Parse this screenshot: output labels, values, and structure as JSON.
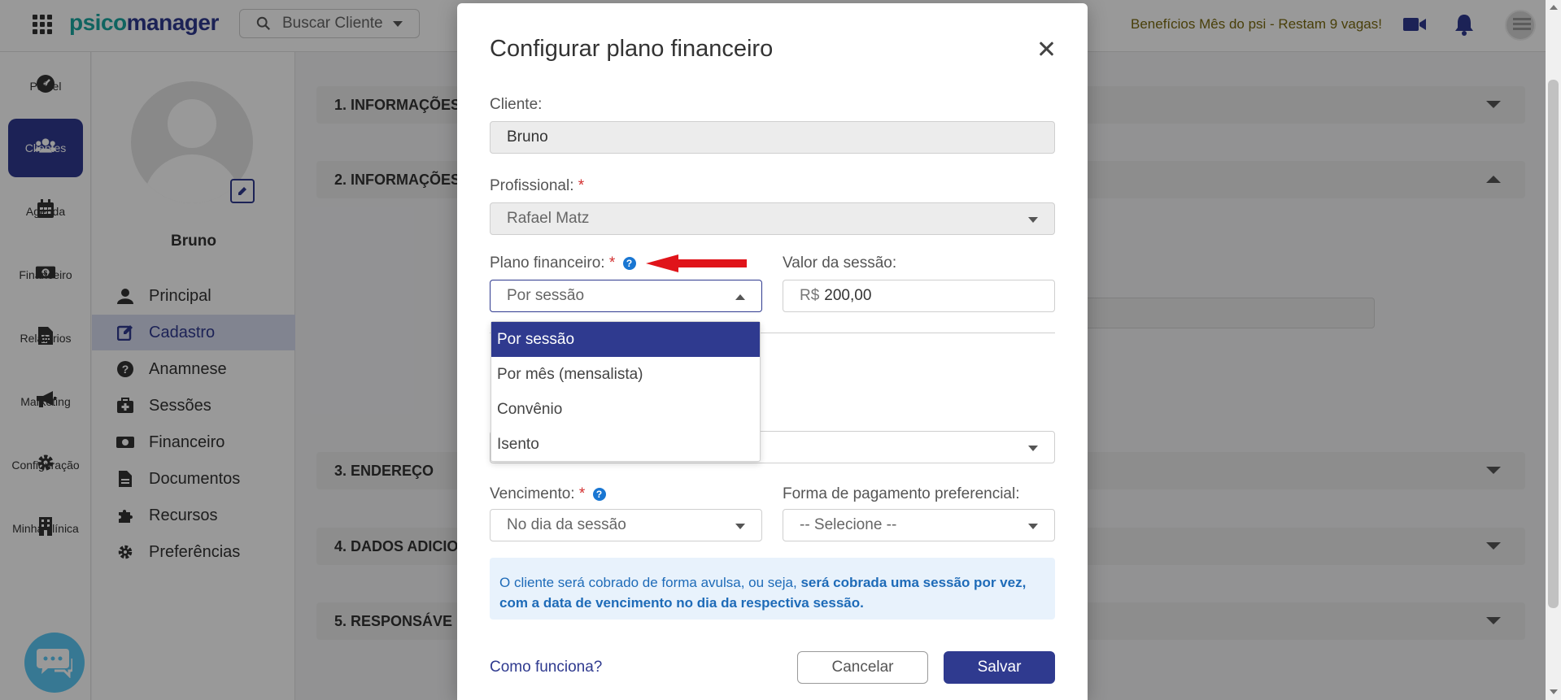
{
  "brand": {
    "logo_part1": "psico",
    "logo_part2": "manager"
  },
  "topbar": {
    "search_label": "Buscar Cliente",
    "promo": "Benefícios Mês do psi - Restam 9 vagas!"
  },
  "nav": {
    "items": [
      {
        "label": "Painel",
        "icon": "dashboard-icon"
      },
      {
        "label": "Clientes",
        "icon": "users-icon",
        "active": true
      },
      {
        "label": "Agenda",
        "icon": "calendar-icon"
      },
      {
        "label": "Financeiro",
        "icon": "money-icon"
      },
      {
        "label": "Relatórios",
        "icon": "document-icon"
      },
      {
        "label": "Marketing",
        "icon": "megaphone-icon"
      },
      {
        "label": "Configuração",
        "icon": "gear-icon"
      },
      {
        "label": "Minha clínica",
        "icon": "building-icon"
      }
    ]
  },
  "profile": {
    "name": "Bruno",
    "menu": [
      {
        "label": "Principal",
        "icon": "user-icon"
      },
      {
        "label": "Cadastro",
        "icon": "edit-icon",
        "active": true
      },
      {
        "label": "Anamnese",
        "icon": "question-icon"
      },
      {
        "label": "Sessões",
        "icon": "medkit-icon"
      },
      {
        "label": "Financeiro",
        "icon": "money-icon"
      },
      {
        "label": "Documentos",
        "icon": "file-icon"
      },
      {
        "label": "Recursos",
        "icon": "puzzle-icon"
      },
      {
        "label": "Preferências",
        "icon": "gear-icon"
      }
    ]
  },
  "sections": [
    {
      "label": "1. INFORMAÇÕES",
      "expanded": false
    },
    {
      "label": "2. INFORMAÇÕES",
      "expanded": true
    },
    {
      "label": "3. ENDEREÇO",
      "expanded": false
    },
    {
      "label": "4. DADOS ADICIO",
      "expanded": false
    },
    {
      "label": "5. RESPONSÁVE",
      "expanded": false
    }
  ],
  "modal": {
    "title": "Configurar plano financeiro",
    "cliente_label": "Cliente:",
    "cliente_value": "Bruno",
    "profissional_label": "Profissional:",
    "profissional_value": "Rafael Matz",
    "plano_label": "Plano financeiro:",
    "plano_value": "Por sessão",
    "valor_label": "Valor da sessão:",
    "valor_currency": "R$",
    "valor_value": "200,00",
    "plano_options": [
      "Por sessão",
      "Por mês (mensalista)",
      "Convênio",
      "Isento"
    ],
    "vencimento_label": "Vencimento:",
    "vencimento_value": "No dia da sessão",
    "pagamento_label": "Forma de pagamento preferencial:",
    "pagamento_value": "-- Selecione --",
    "info_text_1": "O cliente será cobrado de forma avulsa, ou seja, ",
    "info_text_bold": "será cobrada uma sessão por vez, com a data de vencimento no dia da respectiva sessão.",
    "help_link": "Como funciona?",
    "cancel_label": "Cancelar",
    "save_label": "Salvar",
    "required_mark": "*",
    "help_mark": "?"
  },
  "colors": {
    "primary": "#2f3a8f",
    "teal": "#1aa7a1",
    "required": "#d32f2f",
    "info_bg": "#e8f2fc",
    "info_text": "#1e6bb8",
    "arrow": "#e0141a"
  }
}
